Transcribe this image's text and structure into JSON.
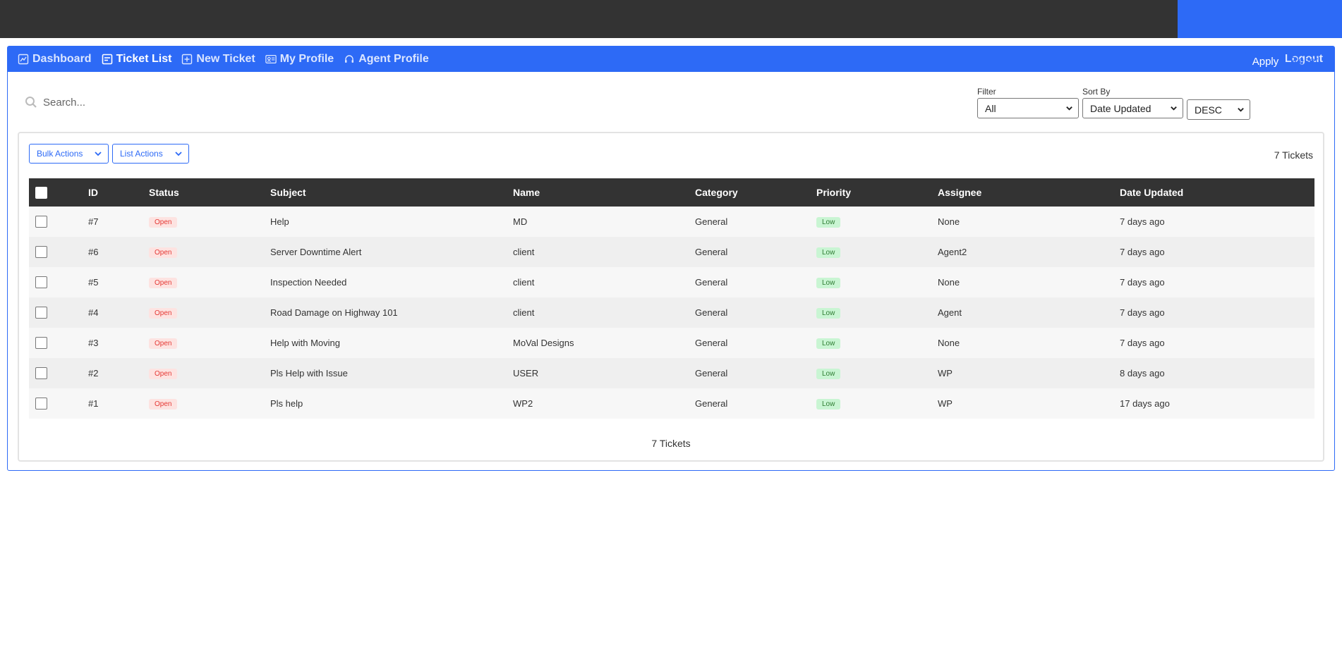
{
  "nav": {
    "items": [
      {
        "label": "Dashboard",
        "icon": "chart-icon"
      },
      {
        "label": "Ticket List",
        "icon": "list-icon"
      },
      {
        "label": "New Ticket",
        "icon": "plus-square-icon"
      },
      {
        "label": "My Profile",
        "icon": "id-card-icon"
      },
      {
        "label": "Agent Profile",
        "icon": "headset-icon"
      }
    ],
    "logout": "Logout"
  },
  "search": {
    "placeholder": "Search..."
  },
  "filters": {
    "filter_label": "Filter",
    "filter_value": "All",
    "sort_label": "Sort By",
    "sort_value": "Date Updated",
    "order_value": "DESC",
    "apply": "Apply",
    "reset": "Reset"
  },
  "actions": {
    "bulk": "Bulk Actions",
    "list": "List Actions"
  },
  "count_label": "7 Tickets",
  "table": {
    "headers": [
      "ID",
      "Status",
      "Subject",
      "Name",
      "Category",
      "Priority",
      "Assignee",
      "Date Updated"
    ],
    "rows": [
      {
        "id": "#7",
        "status": "Open",
        "subject": "Help",
        "name": "MD",
        "category": "General",
        "priority": "Low",
        "assignee": "None",
        "updated": "7 days ago"
      },
      {
        "id": "#6",
        "status": "Open",
        "subject": "Server Downtime Alert",
        "name": "client",
        "category": "General",
        "priority": "Low",
        "assignee": "Agent2",
        "updated": "7 days ago"
      },
      {
        "id": "#5",
        "status": "Open",
        "subject": "Inspection Needed",
        "name": "client",
        "category": "General",
        "priority": "Low",
        "assignee": "None",
        "updated": "7 days ago"
      },
      {
        "id": "#4",
        "status": "Open",
        "subject": "Road Damage on Highway 101",
        "name": "client",
        "category": "General",
        "priority": "Low",
        "assignee": "Agent",
        "updated": "7 days ago"
      },
      {
        "id": "#3",
        "status": "Open",
        "subject": "Help with Moving",
        "name": "MoVal Designs",
        "category": "General",
        "priority": "Low",
        "assignee": "None",
        "updated": "7 days ago"
      },
      {
        "id": "#2",
        "status": "Open",
        "subject": "Pls Help with Issue",
        "name": "USER",
        "category": "General",
        "priority": "Low",
        "assignee": "WP",
        "updated": "8 days ago"
      },
      {
        "id": "#1",
        "status": "Open",
        "subject": "Pls help",
        "name": "WP2",
        "category": "General",
        "priority": "Low",
        "assignee": "WP",
        "updated": "17 days ago"
      }
    ]
  },
  "colors": {
    "accent": "#2d6af6",
    "header_dark": "#333333",
    "open_badge": "#e53935",
    "low_badge": "#2e7d32"
  }
}
